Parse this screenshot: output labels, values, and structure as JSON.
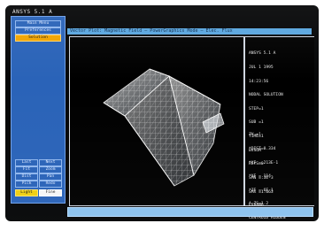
{
  "app": {
    "title": "ANSYS 5.1 A"
  },
  "left_menu": {
    "items": [
      {
        "label": "Main Menu",
        "active": false
      },
      {
        "label": "Preferences",
        "active": false
      },
      {
        "label": "Solution",
        "active": true
      }
    ],
    "bottom_grid": [
      [
        "Last",
        "Next"
      ],
      [
        "Fit",
        "Zoom"
      ],
      [
        "Dist",
        "Pan"
      ],
      [
        "Pick",
        "Redo"
      ],
      [
        "Light",
        "Fine"
      ]
    ]
  },
  "status": {
    "text": "Vector Plot: Magnetic Field — PowerGraphics Mode — Elec. Flux"
  },
  "info_panel": {
    "block1": [
      "ANSYS 5.1 A",
      "JUL 1 1995",
      "14:23:56",
      "NODAL SOLUTION",
      "STEP=1",
      "SUB =1",
      "TIME=1",
      "BVSUM",
      "RSYS=0",
      "SMN =.3E-3",
      "SMX =1.663",
      "EXPAND"
    ],
    "block2": [
      "ZV =1",
      "*DIST=0.334",
      "*XF =.213E-1",
      "*YF =.114",
      "*ZF =.6E-1",
      "A-ZS=1.2",
      "CENTROID HIDDEN"
    ]
  },
  "input": {
    "placeholder": ""
  },
  "colors": {
    "monitor_bg": "#050607",
    "menu_blue": "#2a63b8",
    "accent_orange": "#f2a400",
    "status_blue": "#5aa6df",
    "input_blue": "#8cc2ef"
  }
}
